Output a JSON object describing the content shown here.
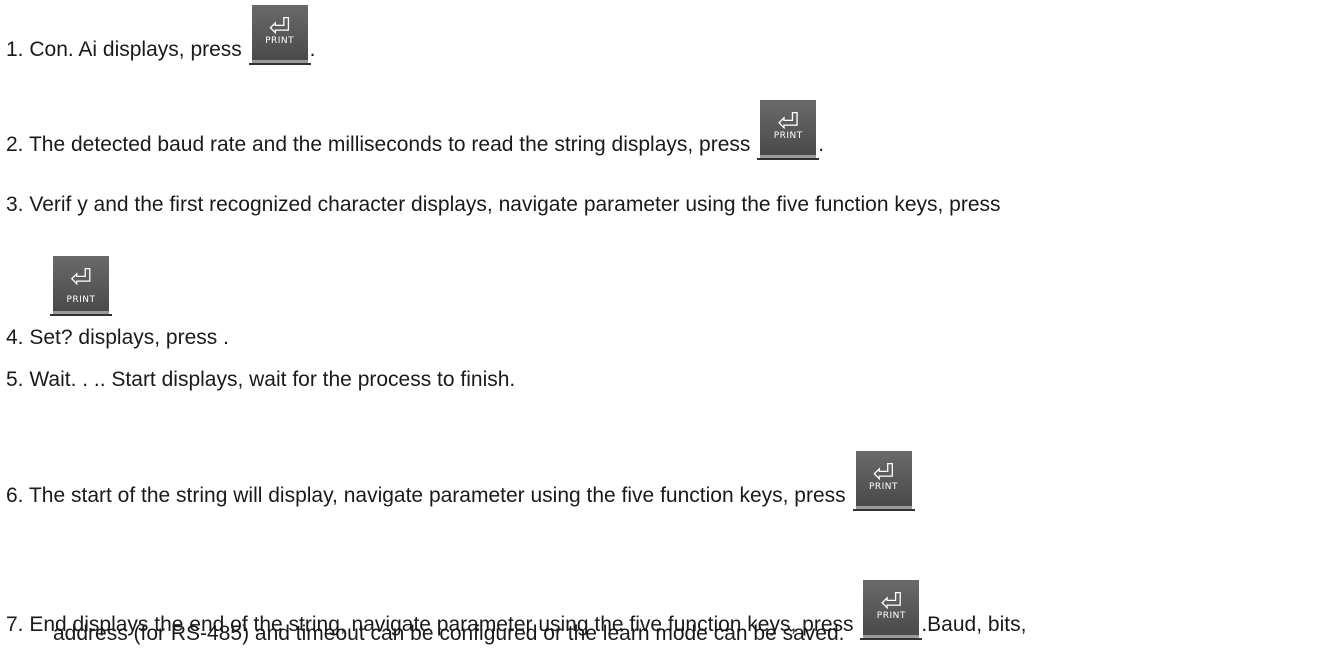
{
  "key": {
    "icon": "enter-arrow-icon",
    "label": "PRINT",
    "glyph": "⏎"
  },
  "steps": [
    {
      "num": "1.",
      "text": "Con. Ai displays, press",
      "after": "."
    },
    {
      "num": "2.",
      "text": "The detected baud rate and the milliseconds to read the string displays, press",
      "after": "."
    },
    {
      "num": "3.",
      "text": "Verif y and the first recognized character displays, navigate parameter using the five function keys, press"
    },
    {
      "num": "4.",
      "text": "Set? displays, press ."
    },
    {
      "num": "5.",
      "text": "Wait. . .. Start displays, wait for the process to finish."
    },
    {
      "num": "6.",
      "text": "The start of the string will display, navigate parameter using the five function keys, press"
    },
    {
      "num": "7.",
      "text": "End displays the end of the string, navigate parameter using the five function keys, press",
      "after": ".Baud, bits,",
      "cont": "address (for RS-485) and timeout can be configured or the learn mode can be saved."
    }
  ]
}
